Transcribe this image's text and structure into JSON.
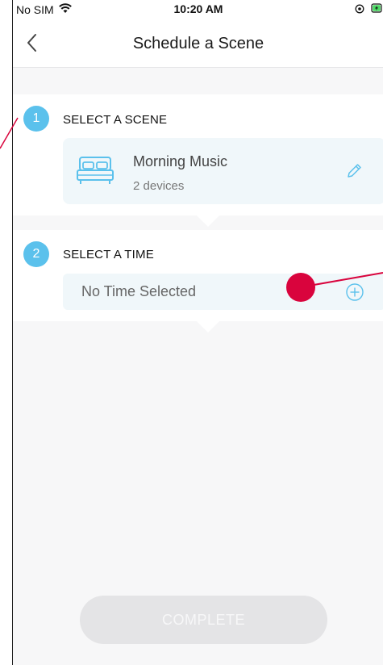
{
  "status_bar": {
    "carrier": "No SIM",
    "time": "10:20 AM"
  },
  "nav": {
    "title": "Schedule a Scene"
  },
  "steps": [
    {
      "number": "1",
      "label": "SELECT A SCENE"
    },
    {
      "number": "2",
      "label": "SELECT A TIME"
    }
  ],
  "scene": {
    "name": "Morning Music",
    "devices": "2 devices"
  },
  "time": {
    "placeholder": "No Time Selected"
  },
  "complete_button": {
    "label": "COMPLETE"
  },
  "colors": {
    "accent": "#5bc1ec",
    "card_background": "#f0f7fa",
    "annotation": "#d9043d"
  }
}
